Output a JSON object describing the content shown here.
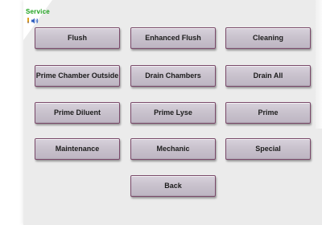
{
  "header": {
    "title": "Service",
    "icons": [
      "pencil-icon",
      "sound-icon"
    ]
  },
  "buttons": {
    "flush": "Flush",
    "enhanced_flush": "Enhanced Flush",
    "cleaning": "Cleaning",
    "prime_chamber_outside": "Prime Chamber Outside",
    "drain_chambers": "Drain Chambers",
    "drain_all": "Drain All",
    "prime_diluent": "Prime Diluent",
    "prime_lyse": "Prime Lyse",
    "prime": "Prime",
    "maintenance": "Maintenance",
    "mechanic": "Mechanic",
    "special": "Special",
    "back": "Back"
  },
  "colors": {
    "title": "#1aa01a",
    "panel": "#ebebeb",
    "button_border": "#7a4a6a",
    "button_face": "#c9c2cd"
  }
}
